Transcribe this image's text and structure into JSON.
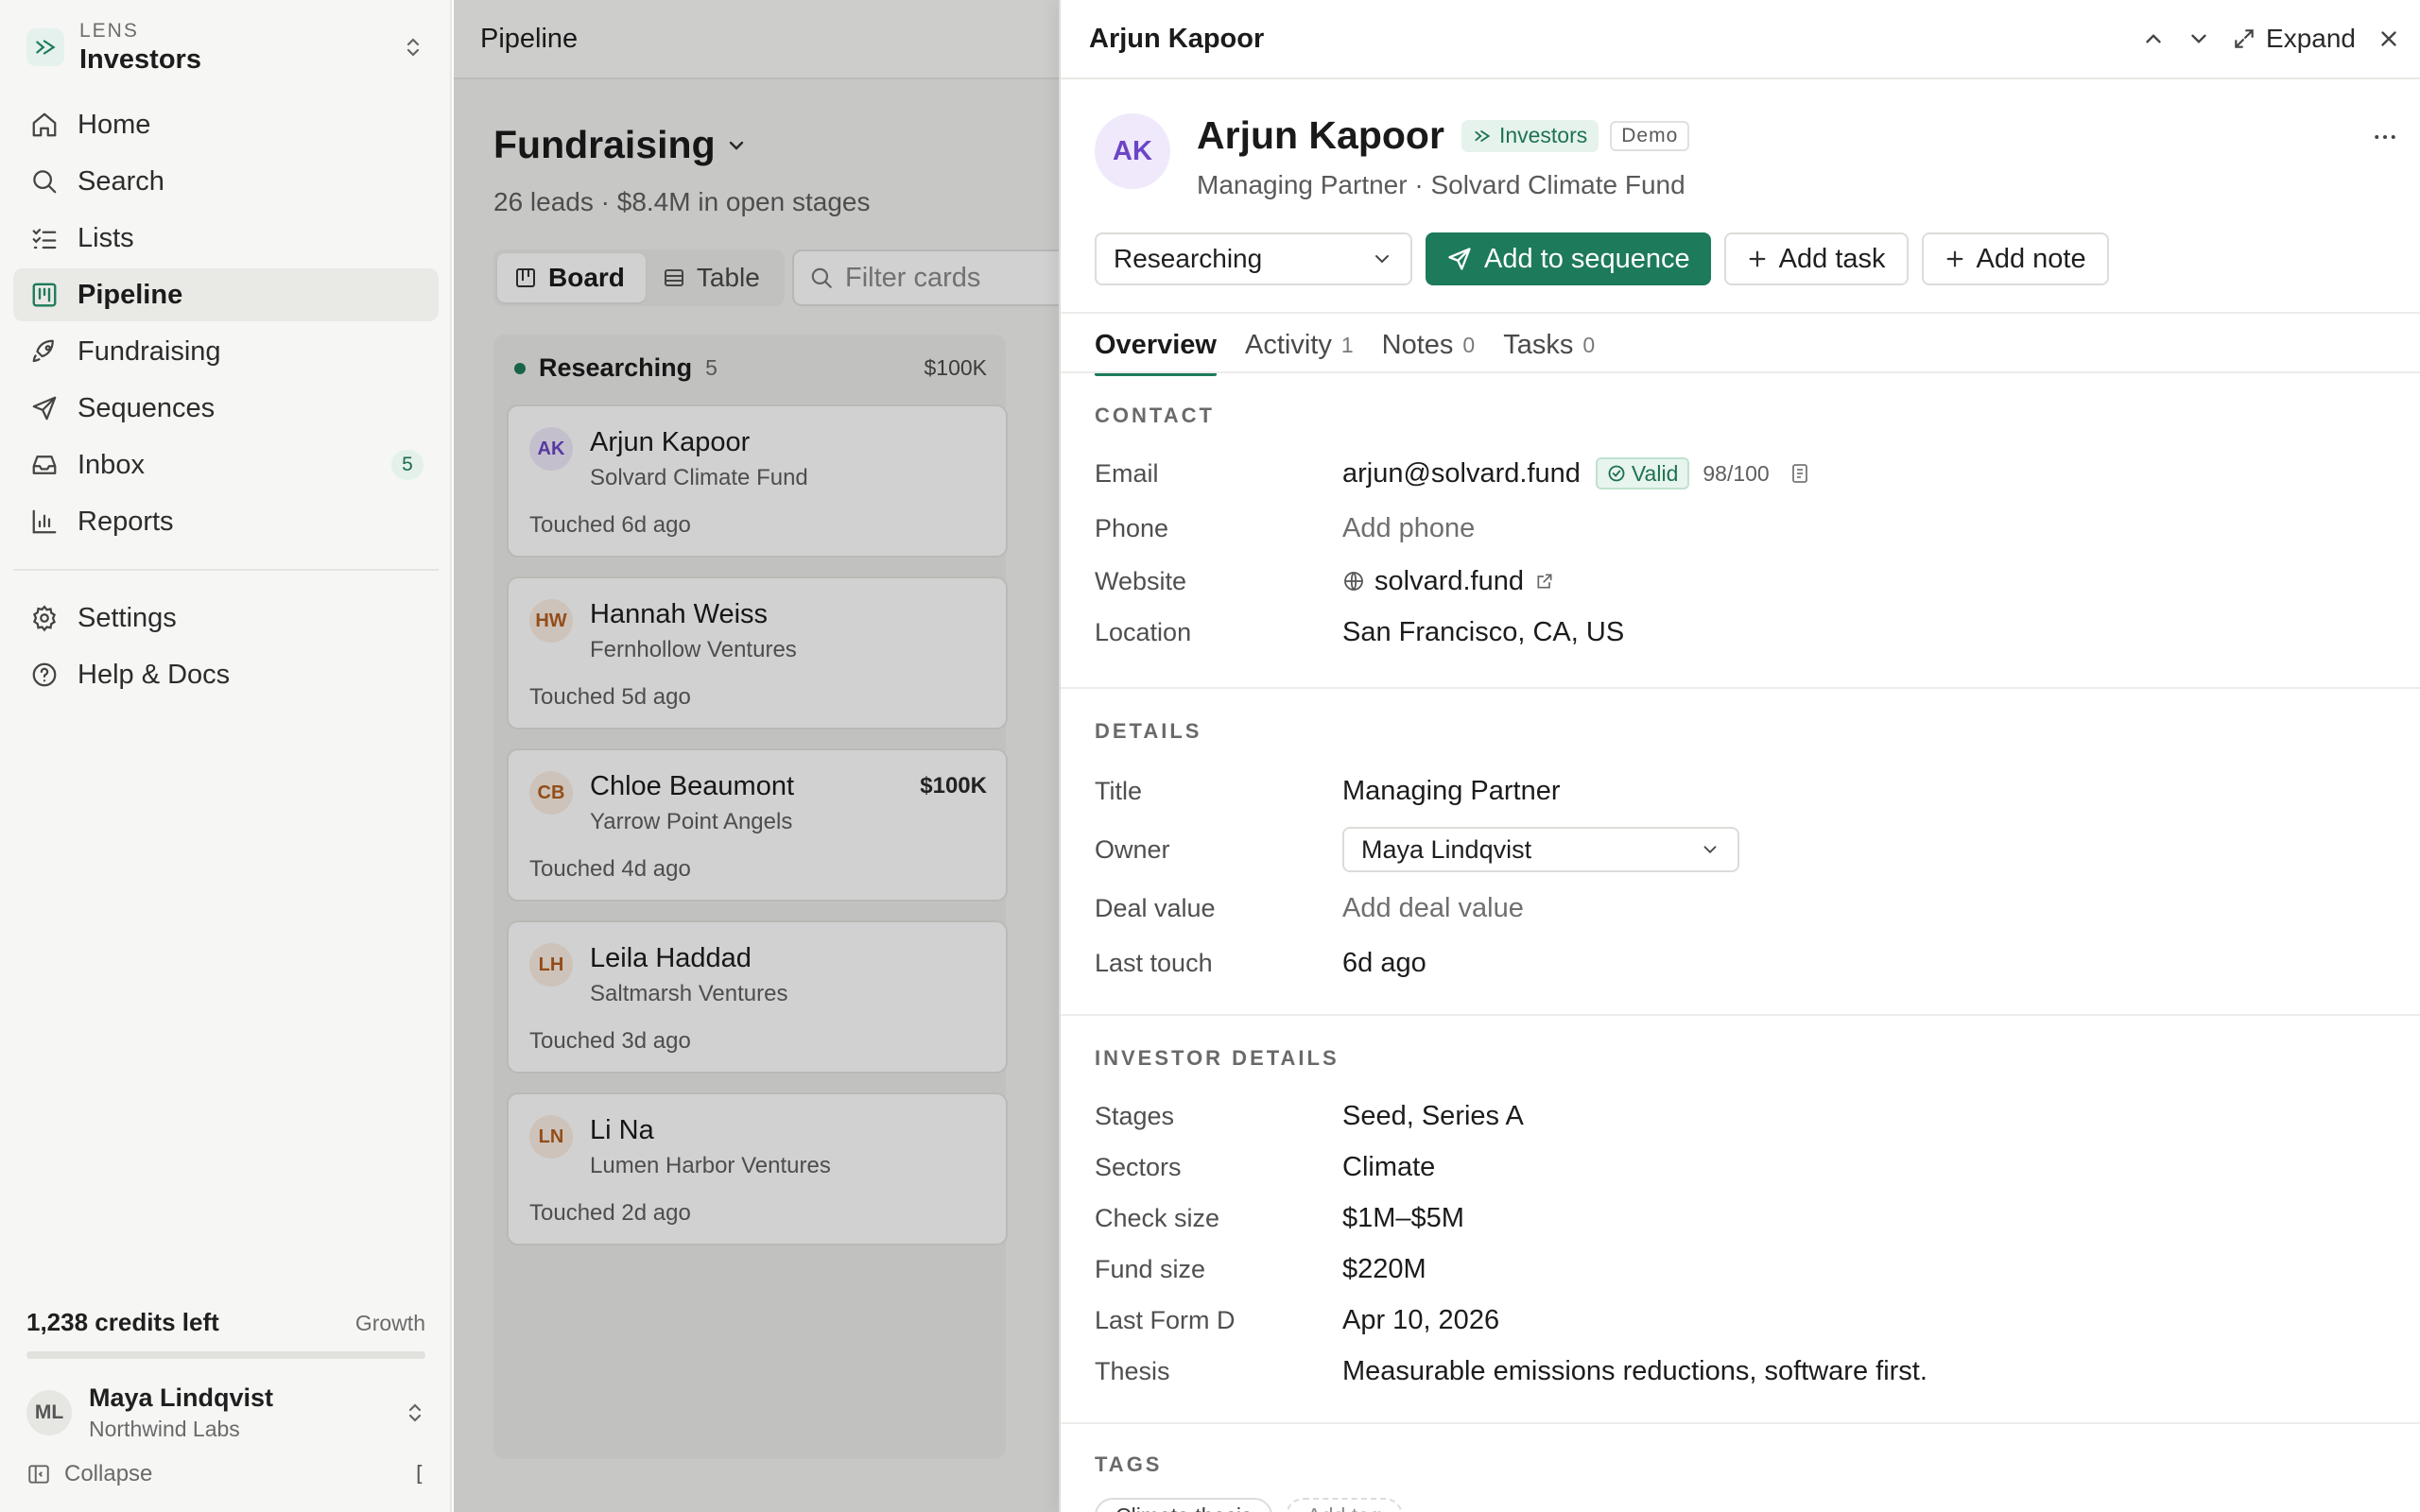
{
  "workspace": {
    "kicker": "LENS",
    "name": "Investors"
  },
  "nav": {
    "items": [
      {
        "label": "Home",
        "icon": "home-icon"
      },
      {
        "label": "Search",
        "icon": "search-icon"
      },
      {
        "label": "Lists",
        "icon": "list-icon"
      },
      {
        "label": "Pipeline",
        "icon": "pipeline-icon",
        "active": true
      },
      {
        "label": "Fundraising",
        "icon": "rocket-icon"
      },
      {
        "label": "Sequences",
        "icon": "send-icon"
      },
      {
        "label": "Inbox",
        "icon": "inbox-icon",
        "badge": "5"
      },
      {
        "label": "Reports",
        "icon": "bar-chart-icon"
      }
    ],
    "secondary": [
      {
        "label": "Settings",
        "icon": "gear-icon"
      },
      {
        "label": "Help & Docs",
        "icon": "help-icon"
      }
    ]
  },
  "credits": {
    "text": "1,238 credits left",
    "plan": "Growth",
    "usage_fraction": 0.0
  },
  "user": {
    "initials": "ML",
    "name": "Maya Lindqvist",
    "org": "Northwind Labs"
  },
  "collapse": {
    "label": "Collapse",
    "shortcut": "["
  },
  "main": {
    "topbar_title": "Pipeline",
    "page_title": "Fundraising",
    "page_subtitle": "26 leads · $8.4M in open stages",
    "view_tabs": [
      {
        "label": "Board",
        "active": true
      },
      {
        "label": "Table",
        "active": false
      }
    ],
    "filter_placeholder": "Filter cards",
    "column": {
      "name": "Researching",
      "count": "5",
      "value": "$100K"
    },
    "cards": [
      {
        "initials": "AK",
        "name": "Arjun Kapoor",
        "org": "Solvard Climate Fund",
        "touched": "Touched 6d ago",
        "amount": "",
        "av_bg": "#efe9fb",
        "av_fg": "#6b45c6"
      },
      {
        "initials": "HW",
        "name": "Hannah Weiss",
        "org": "Fernhollow Ventures",
        "touched": "Touched 5d ago",
        "amount": "",
        "av_bg": "#fbeee3",
        "av_fg": "#b35e1e"
      },
      {
        "initials": "CB",
        "name": "Chloe Beaumont",
        "org": "Yarrow Point Angels",
        "touched": "Touched 4d ago",
        "amount": "$100K",
        "av_bg": "#fbeee3",
        "av_fg": "#b35e1e"
      },
      {
        "initials": "LH",
        "name": "Leila Haddad",
        "org": "Saltmarsh Ventures",
        "touched": "Touched 3d ago",
        "amount": "",
        "av_bg": "#fbeee3",
        "av_fg": "#b35e1e"
      },
      {
        "initials": "LN",
        "name": "Li Na",
        "org": "Lumen Harbor Ventures",
        "touched": "Touched 2d ago",
        "amount": "",
        "av_bg": "#fbeee3",
        "av_fg": "#b35e1e"
      }
    ]
  },
  "panel": {
    "title": "Arjun Kapoor",
    "expand_label": "Expand",
    "initials": "AK",
    "name": "Arjun Kapoor",
    "chip_investors": "Investors",
    "chip_demo": "Demo",
    "subtitle": "Managing Partner · Solvard Climate Fund",
    "status": "Researching",
    "add_sequence": "Add to sequence",
    "add_task": "Add task",
    "add_note": "Add note",
    "tabs": [
      {
        "label": "Overview",
        "count": "",
        "active": true
      },
      {
        "label": "Activity",
        "count": "1"
      },
      {
        "label": "Notes",
        "count": "0"
      },
      {
        "label": "Tasks",
        "count": "0"
      }
    ],
    "contact": {
      "title": "CONTACT",
      "email_label": "Email",
      "email": "arjun@solvard.fund",
      "email_status": "Valid",
      "email_score": "98/100",
      "phone_label": "Phone",
      "phone": "Add phone",
      "website_label": "Website",
      "website": "solvard.fund",
      "location_label": "Location",
      "location": "San Francisco, CA, US"
    },
    "details": {
      "title": "DETAILS",
      "title_label": "Title",
      "title_value": "Managing Partner",
      "owner_label": "Owner",
      "owner": "Maya Lindqvist",
      "deal_label": "Deal value",
      "deal": "Add deal value",
      "touch_label": "Last touch",
      "touch": "6d ago"
    },
    "investor": {
      "title": "INVESTOR DETAILS",
      "rows": [
        {
          "k": "Stages",
          "v": "Seed, Series A"
        },
        {
          "k": "Sectors",
          "v": "Climate"
        },
        {
          "k": "Check size",
          "v": "$1M–$5M"
        },
        {
          "k": "Fund size",
          "v": "$220M"
        },
        {
          "k": "Last Form D",
          "v": "Apr 10, 2026"
        },
        {
          "k": "Thesis",
          "v": "Measurable emissions reductions, software first."
        }
      ]
    },
    "tags": {
      "title": "TAGS",
      "items": [
        "Climate thesis"
      ],
      "add_label": "Add tag"
    },
    "colors": {
      "accent": "#1d7a5a"
    }
  }
}
